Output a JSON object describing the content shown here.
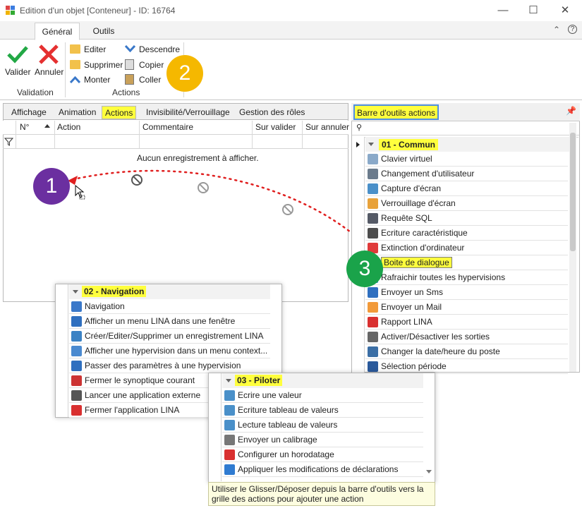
{
  "window": {
    "title": "Edition d'un objet [Conteneur] - ID: 16764",
    "minimize": "—",
    "maximize": "☐",
    "close": "✕"
  },
  "ribbon": {
    "tabs": [
      "Général",
      "Outils"
    ],
    "active_tab": "Général",
    "help": "?",
    "collapse": "⌃",
    "validation": {
      "label": "Validation",
      "valider": "Valider",
      "annuler": "Annuler"
    },
    "actions": {
      "label": "Actions",
      "editer": "Editer",
      "supprimer": "Supprimer",
      "monter": "Monter",
      "descendre": "Descendre",
      "copier": "Copier",
      "coller": "Coller"
    }
  },
  "badges": {
    "b1": "1",
    "b2": "2",
    "b3": "3"
  },
  "left_panel": {
    "tabs": [
      "Affichage",
      "Animation",
      "Actions",
      "Invisibilité/Verrouillage",
      "Gestion des rôles"
    ],
    "active_tab": "Actions",
    "columns": [
      "N°",
      "Action",
      "Commentaire",
      "Sur valider",
      "Sur annuler"
    ],
    "empty_message": "Aucun enregistrement à afficher."
  },
  "toolbar_panel": {
    "title": "Barre d'outils actions",
    "groups": {
      "commun": {
        "title": "01 - Commun",
        "items": [
          "Clavier virtuel",
          "Changement d'utilisateur",
          "Capture d'écran",
          "Verrouillage d'écran",
          "Requête SQL",
          "Ecriture caractéristique",
          "Extinction d'ordinateur",
          "Boite de dialogue",
          "Rafraichir toutes les hypervisions",
          "Envoyer un Sms",
          "Envoyer un Mail",
          "Rapport LINA",
          "Activer/Désactiver les sorties",
          "Changer la date/heure du poste",
          "Sélection période"
        ]
      },
      "navigation": {
        "title": "02 - Navigation",
        "items": [
          "Navigation",
          "Afficher un menu LINA dans une fenêtre",
          "Créer/Editer/Supprimer un enregistrement LINA",
          "Afficher une hypervision dans un menu context...",
          "Passer des paramètres à une hypervision",
          "Fermer le synoptique courant",
          "Lancer une application externe",
          "Fermer l'application LINA"
        ]
      },
      "piloter": {
        "title": "03 - Piloter",
        "items": [
          "Ecrire une valeur",
          "Ecriture tableau de valeurs",
          "Lecture tableau de valeurs",
          "Envoyer un calibrage",
          "Configurer un horodatage",
          "Appliquer les modifications de déclarations"
        ]
      }
    }
  },
  "tooltip": "Utiliser le Glisser/Déposer depuis la barre d'outils vers la grille des actions pour ajouter une action",
  "colors": {
    "highlight": "#ffff3d",
    "badge1": "#6b2fa0",
    "badge2": "#f5b800",
    "badge3": "#1aa34a",
    "drag_line": "#e02020"
  }
}
